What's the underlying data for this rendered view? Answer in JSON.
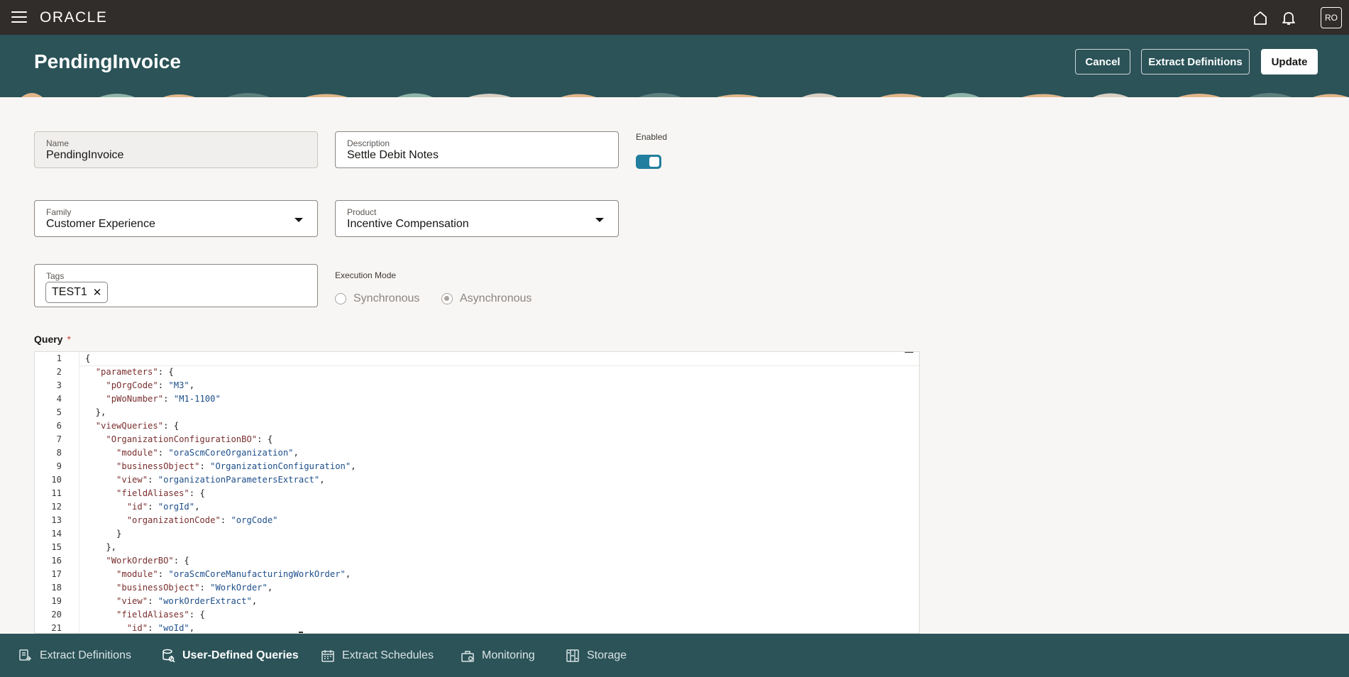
{
  "topbar": {
    "logo": "ORACLE",
    "avatar": "RO",
    "icons": [
      "menu-icon",
      "home-icon",
      "bell-icon"
    ]
  },
  "header": {
    "title": "PendingInvoice",
    "cancel_label": "Cancel",
    "extract_definitions_label": "Extract Definitions",
    "update_label": "Update"
  },
  "form": {
    "name_label": "Name",
    "name_value": "PendingInvoice",
    "description_label": "Description",
    "description_value": "Settle Debit Notes",
    "enabled_label": "Enabled",
    "enabled": true,
    "family_label": "Family",
    "family_value": "Customer Experience",
    "product_label": "Product",
    "product_value": "Incentive Compensation",
    "tags_label": "Tags",
    "tags": [
      "TEST1"
    ],
    "execution_mode_label": "Execution Mode",
    "execution_modes": [
      "Synchronous",
      "Asynchronous"
    ],
    "execution_mode_selected": "Asynchronous",
    "query_label": "Query",
    "query_required": "*"
  },
  "editor": {
    "lines": [
      "{",
      "  \"parameters\": {",
      "    \"pOrgCode\": \"M3\",",
      "    \"pWoNumber\": \"M1-1100\"",
      "  },",
      "  \"viewQueries\": {",
      "    \"OrganizationConfigurationBO\": {",
      "      \"module\": \"oraScmCoreOrganization\",",
      "      \"businessObject\": \"OrganizationConfiguration\",",
      "      \"view\": \"organizationParametersExtract\",",
      "      \"fieldAliases\": {",
      "        \"id\": \"orgId\",",
      "        \"organizationCode\": \"orgCode\"",
      "      }",
      "    },",
      "    \"WorkOrderBO\": {",
      "      \"module\": \"oraScmCoreManufacturingWorkOrder\",",
      "      \"businessObject\": \"WorkOrder\",",
      "      \"view\": \"workOrderExtract\",",
      "      \"fieldAliases\": {",
      "        \"id\": \"woId\","
    ]
  },
  "bottomnav": {
    "items": [
      {
        "label": "Extract Definitions",
        "icon": "extract-definitions-icon"
      },
      {
        "label": "User-Defined Queries",
        "icon": "user-defined-queries-icon"
      },
      {
        "label": "Extract Schedules",
        "icon": "calendar-icon"
      },
      {
        "label": "Monitoring",
        "icon": "monitoring-icon"
      },
      {
        "label": "Storage",
        "icon": "storage-icon"
      }
    ],
    "active": "User-Defined Queries"
  },
  "colors": {
    "topbar": "#312d2a",
    "header": "#2b5358",
    "accent": "#227e9e",
    "page": "#f8f6f4"
  }
}
